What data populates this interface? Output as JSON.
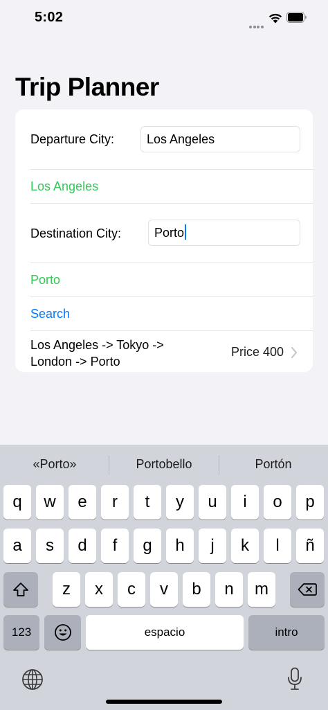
{
  "status_bar": {
    "time": "5:02"
  },
  "title": "Trip Planner",
  "form": {
    "departure_label": "Departure City:",
    "departure_value": "Los Angeles",
    "departure_echo": "Los Angeles",
    "destination_label": "Destination City:",
    "destination_value": "Porto",
    "destination_echo": "Porto",
    "search_label": "Search",
    "result": {
      "route_line1": "Los Angeles -> Tokyo ->",
      "route_line2": "London -> Porto",
      "price": "Price 400"
    }
  },
  "keyboard": {
    "suggestions": [
      "«Porto»",
      "Portobello",
      "Portón"
    ],
    "row1": [
      "q",
      "w",
      "e",
      "r",
      "t",
      "y",
      "u",
      "i",
      "o",
      "p"
    ],
    "row2": [
      "a",
      "s",
      "d",
      "f",
      "g",
      "h",
      "j",
      "k",
      "l",
      "ñ"
    ],
    "row3": [
      "z",
      "x",
      "c",
      "v",
      "b",
      "n",
      "m"
    ],
    "numbers_label": "123",
    "space_label": "espacio",
    "return_label": "intro"
  },
  "colors": {
    "accent": "#007aff",
    "echo_green": "#34c759",
    "background": "#f2f2f7"
  }
}
